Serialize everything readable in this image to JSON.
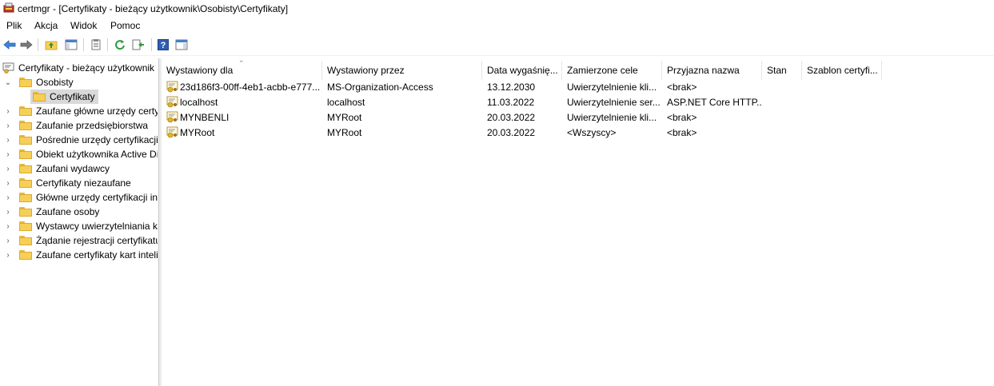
{
  "window": {
    "title": "certmgr - [Certyfikaty - bieżący użytkownik\\Osobisty\\Certyfikaty]"
  },
  "menu": [
    "Plik",
    "Akcja",
    "Widok",
    "Pomoc"
  ],
  "toolbar": {
    "icons": [
      "back-icon",
      "forward-icon",
      "up-folder-icon",
      "show-hide-tree-icon",
      "properties-icon",
      "refresh-icon",
      "export-list-icon",
      "help-icon",
      "show-hide-action-pane-icon"
    ]
  },
  "tree": {
    "root": "Certyfikaty - bieżący użytkownik",
    "items": [
      {
        "label": "Osobisty",
        "expanded": true
      },
      {
        "label": "Certyfikaty",
        "selected": true
      },
      {
        "label": "Zaufane główne urzędy certyf"
      },
      {
        "label": "Zaufanie przedsiębiorstwa"
      },
      {
        "label": "Pośrednie urzędy certyfikacji"
      },
      {
        "label": "Obiekt użytkownika Active Di"
      },
      {
        "label": "Zaufani wydawcy"
      },
      {
        "label": "Certyfikaty niezaufane"
      },
      {
        "label": "Główne urzędy certyfikacji inn"
      },
      {
        "label": "Zaufane osoby"
      },
      {
        "label": "Wystawcy uwierzytelniania kli"
      },
      {
        "label": "Żądanie rejestracji certyfikatu"
      },
      {
        "label": "Zaufane certyfikaty kart inteli"
      }
    ]
  },
  "list": {
    "columns": [
      "Wystawiony dla",
      "Wystawiony przez",
      "Data wygaśnię...",
      "Zamierzone cele",
      "Przyjazna nazwa",
      "Stan",
      "Szablon certyfi..."
    ],
    "rows": [
      [
        "23d186f3-00ff-4eb1-acbb-e777...",
        "MS-Organization-Access",
        "13.12.2030",
        "Uwierzytelnienie kli...",
        "<brak>",
        "",
        ""
      ],
      [
        "localhost",
        "localhost",
        "11.03.2022",
        "Uwierzytelnienie ser...",
        "ASP.NET Core HTTP...",
        "",
        ""
      ],
      [
        "MYNBENLI",
        "MYRoot",
        "20.03.2022",
        "Uwierzytelnienie kli...",
        "<brak>",
        "",
        ""
      ],
      [
        "MYRoot",
        "MYRoot",
        "20.03.2022",
        "<Wszyscy>",
        "<brak>",
        "",
        ""
      ]
    ]
  }
}
